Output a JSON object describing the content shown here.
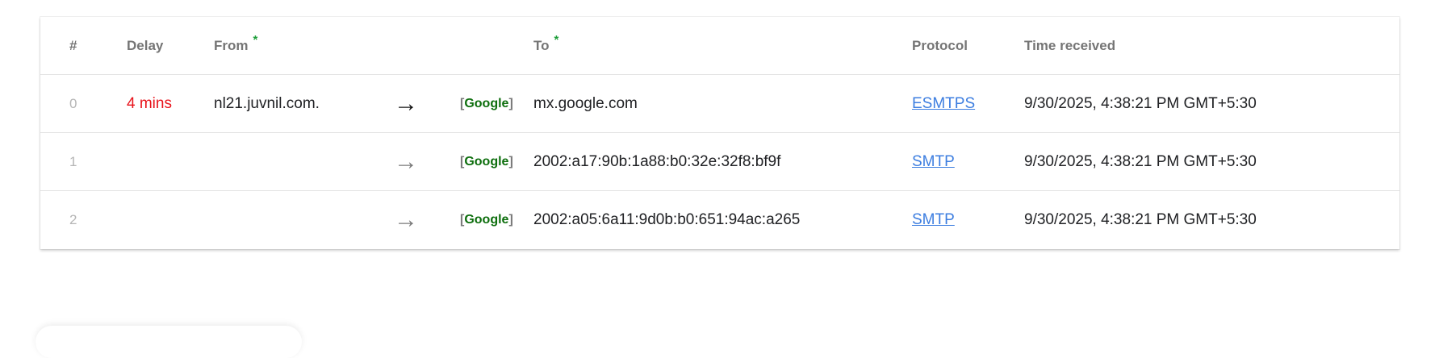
{
  "table": {
    "headers": {
      "num": "#",
      "delay": "Delay",
      "from": "From",
      "from_marker": "*",
      "to": "To",
      "to_marker": "*",
      "protocol": "Protocol",
      "time": "Time received"
    },
    "rows": [
      {
        "index": "0",
        "delay": "4 mins",
        "from": "nl21.juvnil.com.",
        "arrow": "→",
        "badge_open": "[",
        "badge": "Google",
        "badge_close": "]",
        "to": "mx.google.com",
        "protocol": "ESMTPS",
        "time": "9/30/2025, 4:38:21 PM GMT+5:30"
      },
      {
        "index": "1",
        "delay": "",
        "from": "",
        "arrow": "→",
        "badge_open": "[",
        "badge": "Google",
        "badge_close": "]",
        "to": "2002:a17:90b:1a88:b0:32e:32f8:bf9f",
        "protocol": "SMTP",
        "time": "9/30/2025, 4:38:21 PM GMT+5:30"
      },
      {
        "index": "2",
        "delay": "",
        "from": "",
        "arrow": "→",
        "badge_open": "[",
        "badge": "Google",
        "badge_close": "]",
        "to": "2002:a05:6a11:9d0b:b0:651:94ac:a265",
        "protocol": "SMTP",
        "time": "9/30/2025, 4:38:21 PM GMT+5:30"
      }
    ]
  },
  "colors": {
    "delay": "#e8141c",
    "required_marker": "#1e9e3a",
    "badge": "#0d6e0d",
    "link": "#3d7ee0",
    "header_text": "#757575"
  }
}
